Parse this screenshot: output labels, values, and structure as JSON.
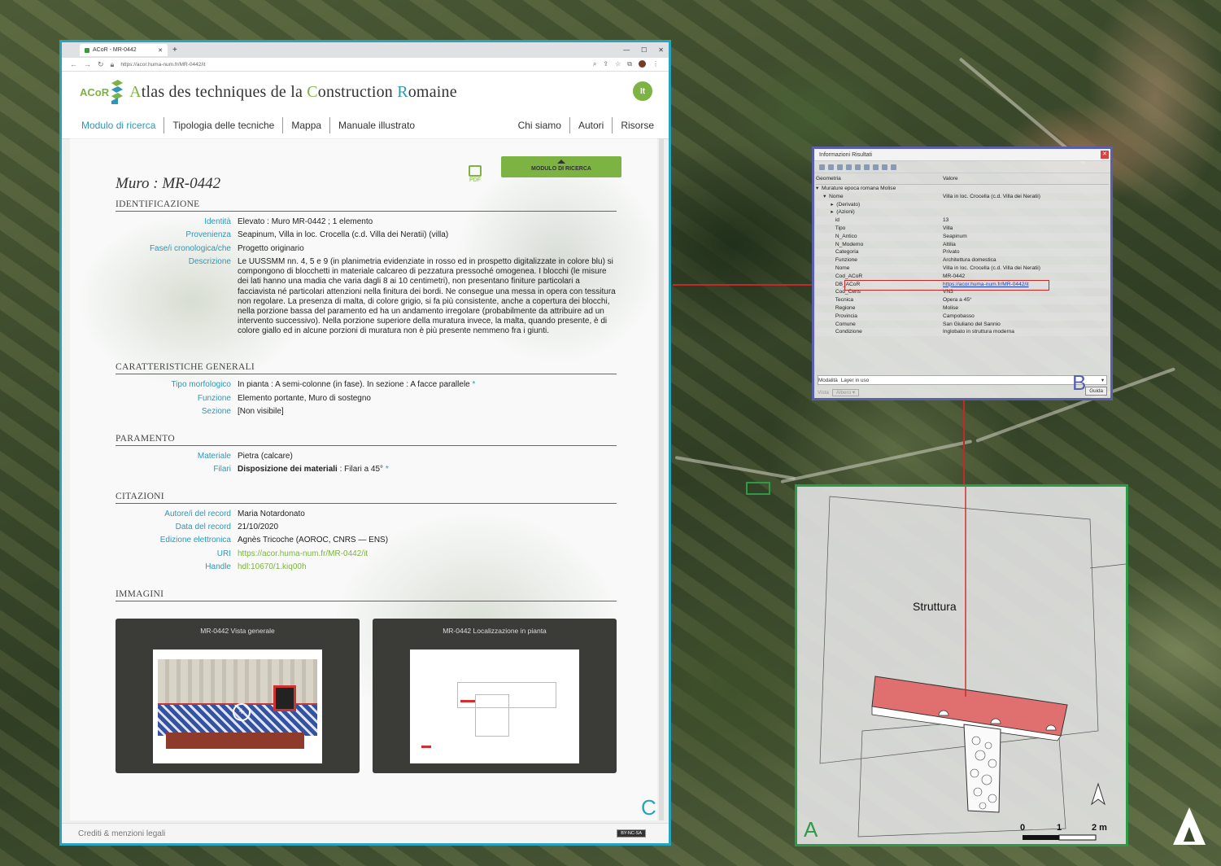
{
  "browser": {
    "tab_title": "ACoR - MR-0442",
    "url": "https://acor.huma-num.fr/MR-0442/it"
  },
  "site": {
    "logo_text": "ACoR",
    "title_parts": [
      "A",
      "tlas des techniques de la ",
      "C",
      "onstruction ",
      "R",
      "omaine"
    ],
    "lang": "It",
    "menu_left": [
      "Modulo di ricerca",
      "Tipologia delle tecniche",
      "Mappa",
      "Manuale illustrato"
    ],
    "menu_right": [
      "Chi siamo",
      "Autori",
      "Risorse"
    ],
    "pdf_label": "PDF",
    "modulo_button": "MODULO DI RICERCA"
  },
  "record": {
    "title": "Muro : MR-0442",
    "sections": {
      "identificazione": "IDENTIFICAZIONE",
      "caratteristiche": "CARATTERISTICHE GENERALI",
      "paramento": "PARAMENTO",
      "citazioni": "CITAZIONI",
      "immagini": "IMMAGINI"
    },
    "identificazione": [
      {
        "label": "Identità",
        "value": "Elevato : Muro MR-0442 ; 1 elemento"
      },
      {
        "label": "Provenienza",
        "value": "Seapinum, Villa in loc. Crocella (c.d. Villa dei Neratii) (villa)"
      },
      {
        "label": "Fase/i cronologica/che",
        "value": "Progetto originario"
      },
      {
        "label": "Descrizione",
        "value": "Le UUSSMM nn. 4, 5 e 9 (in planimetria evidenziate in rosso ed in prospetto digitalizzate in colore blu) si compongono di blocchetti in materiale calcareo di pezzatura pressoché omogenea. I blocchi (le misure dei lati hanno una madia che varia dagli 8 ai 10 centimetri), non presentano finiture particolari a facciavista né particolari attenzioni nella finitura dei bordi. Ne consegue una messa in opera con tessitura non regolare. La presenza di malta, di colore grigio, si fa più consistente, anche a copertura dei blocchi, nella porzione bassa del paramento ed ha un andamento irregolare (probabilmente da attribuire ad un intervento successivo). Nella porzione superiore della muratura invece, la malta, quando presente, è di colore giallo ed in alcune porzioni di muratura non è più presente nemmeno fra i giunti."
      }
    ],
    "caratteristiche": [
      {
        "label": "Tipo morfologico",
        "value": "In pianta : A semi-colonne (in fase). In sezione : A facce parallele",
        "star": "*"
      },
      {
        "label": "Funzione",
        "value": "Elemento portante, Muro di sostegno"
      },
      {
        "label": "Sezione",
        "value": "[Non visibile]"
      }
    ],
    "paramento": [
      {
        "label": "Materiale",
        "value": "Pietra (calcare)"
      },
      {
        "label": "Filari",
        "bold": "Disposizione dei materiali",
        "value": " : Filari a 45°",
        "star": "*"
      }
    ],
    "citazioni": [
      {
        "label": "Autore/i del record",
        "value": "Maria Notardonato"
      },
      {
        "label": "Data del record",
        "value": "21/10/2020"
      },
      {
        "label": "Edizione elettronica",
        "value": "Agnès Tricoche (AOROC, CNRS — ENS)"
      },
      {
        "label": "URI",
        "value": "https://acor.huma-num.fr/MR-0442/it"
      },
      {
        "label": "Handle",
        "value": "hdl:10670/1.kiq00h"
      }
    ],
    "images": [
      {
        "caption": "MR-0442  Vista generale"
      },
      {
        "caption": "MR-0442  Localizzazione in pianta"
      }
    ]
  },
  "footer": {
    "credits": "Crediti & menzioni legali",
    "license": "BY-NC-SA"
  },
  "panel_letters": {
    "a": "A",
    "b": "B",
    "c": "C"
  },
  "qgis": {
    "title": "Informazioni Risultati",
    "col_geom": "Geometria",
    "col_val": "Valore",
    "rows": [
      {
        "k": "▾  Murature epoca romana Molise",
        "v": ""
      },
      {
        "k": "     ▾  Nome",
        "v": "Villa in loc. Crocella (c.d. Villa dei Neratii)"
      },
      {
        "k": "          ▸  (Derivato)",
        "v": ""
      },
      {
        "k": "          ▸  (Azioni)",
        "v": ""
      },
      {
        "k": "             id",
        "v": "13"
      },
      {
        "k": "             Tipo",
        "v": "Villa"
      },
      {
        "k": "             N_Antico",
        "v": "Seapinum"
      },
      {
        "k": "             N_Moderno",
        "v": "Altilia"
      },
      {
        "k": "             Categoria",
        "v": "Privato"
      },
      {
        "k": "             Funzione",
        "v": "Architettura domestica"
      },
      {
        "k": "             Nome",
        "v": "Villa in loc. Crocella (c.d. Villa dei Neratii)"
      },
      {
        "k": "             Cod_ACoR",
        "v": "MR-0442"
      },
      {
        "k": "             DB_ACoR",
        "v": "https://acor.huma-num.fr/MR-0442/it",
        "link": true
      },
      {
        "k": "             Cod_Cens",
        "v": "VN3"
      },
      {
        "k": "             Tecnica",
        "v": "Opera a 45°"
      },
      {
        "k": "             Regione",
        "v": "Molise"
      },
      {
        "k": "             Provincia",
        "v": "Campobasso"
      },
      {
        "k": "             Comune",
        "v": "San Giuliano del Sannio"
      },
      {
        "k": "             Condizione",
        "v": "Inglobato in struttura moderna"
      }
    ],
    "modalita_label": "Modalità",
    "modalita_value": "Layer in uso",
    "vista_label": "Vista",
    "vista_value": "Albero",
    "guida": "Guida"
  },
  "plan": {
    "label": "Struttura",
    "scale_labels": [
      "0",
      "1",
      "2 m"
    ],
    "accent_red": "#e07070"
  }
}
